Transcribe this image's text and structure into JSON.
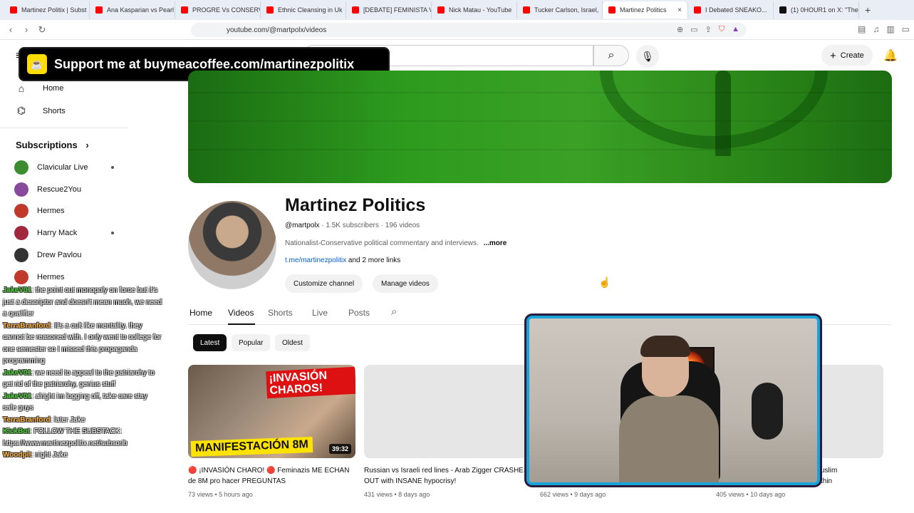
{
  "browser": {
    "tabs": [
      {
        "label": "Martinez Politix | Subst",
        "icon": "substack-icon"
      },
      {
        "label": "Ana Kasparian vs Pearl",
        "icon": "youtube-icon"
      },
      {
        "label": "PROGRE Vs CONSERV",
        "icon": "youtube-icon"
      },
      {
        "label": "Ethnic Cleansing in Uk",
        "icon": "youtube-icon"
      },
      {
        "label": "[DEBATE] FEMINISTA V",
        "icon": "youtube-icon"
      },
      {
        "label": "Nick Matau - YouTube",
        "icon": "youtube-icon"
      },
      {
        "label": "Tucker Carlson, Israel,",
        "icon": "youtube-icon"
      },
      {
        "label": "Martinez Politics",
        "icon": "youtube-icon",
        "active": true
      },
      {
        "label": "I Debated SNEAKO...",
        "icon": "youtube-icon"
      },
      {
        "label": "(1) 0HOUR1 on X: \"The",
        "icon": "x-icon"
      }
    ],
    "url": "youtube.com/@martpolx/videos"
  },
  "youtube_header": {
    "create_label": "Create"
  },
  "overlay_banner": {
    "text": "Support me at buymeacoffee.com/martinezpolitix"
  },
  "sidebar": {
    "nav": [
      {
        "label": "Home",
        "icon": "home-icon"
      },
      {
        "label": "Shorts",
        "icon": "shorts-icon"
      }
    ],
    "subscriptions_label": "Subscriptions",
    "subscriptions": [
      {
        "name": "Clavicular Live",
        "live": true,
        "color": "#3b8d2f"
      },
      {
        "name": "Rescue2You",
        "live": false,
        "color": "#8a4a9c"
      },
      {
        "name": "Hermes",
        "live": false,
        "color": "#c0392b"
      },
      {
        "name": "Harry Mack",
        "live": true,
        "color": "#a0283c"
      },
      {
        "name": "Drew Pavlou",
        "live": false,
        "color": "#333333"
      },
      {
        "name": "Hermes",
        "live": false,
        "color": "#c0392b"
      }
    ]
  },
  "chat": [
    {
      "user": "JakeV01",
      "text": ": the point out monopoly on force but it's just a descriptor and doesn't mean much, we need a qualifier"
    },
    {
      "user": "TerraBranford",
      "text": ": It's a cult like mentality. they cannot be reasoned with. I only went to college for one semester so I missed this propaganda programming"
    },
    {
      "user": "JakeV01",
      "text": ": we need to appeal to the patriarchy to get rid of the patriarchy, genius stuff"
    },
    {
      "user": "JakeV01",
      "text": ": alright im logging off, take care stay safe guys"
    },
    {
      "user": "TerraBranford",
      "text": ": later Jake"
    },
    {
      "user": "KickBot",
      "text": ": FOLLOW THE SUBSTACK: https://www.martinezpolitix.net/subscrib"
    },
    {
      "user": "Woodpit",
      "text": ": night Jake"
    }
  ],
  "channel": {
    "name": "Martinez Politics",
    "handle": "@martpolx",
    "subscribers": "1.5K subscribers",
    "videos_count": "196 videos",
    "description": "Nationalist-Conservative political commentary and interviews.",
    "more_label": "...more",
    "link": "t.me/martinezpolitix",
    "more_links": "and 2 more links",
    "customize_label": "Customize channel",
    "manage_label": "Manage videos"
  },
  "channel_tabs": [
    "Home",
    "Videos",
    "Shorts",
    "Live",
    "Posts"
  ],
  "filter_chips": [
    "Latest",
    "Popular",
    "Oldest"
  ],
  "videos": [
    {
      "title": "🔴 ¡INVASIÓN CHARO! 🔴 Feminazis ME ECHAN de 8M pro hacer PREGUNTAS",
      "meta": "73 views • 5 hours ago",
      "duration": "39:32",
      "thumb_text_top": "¡INVASIÓN CHAROS!",
      "thumb_text_bottom": "MANIFESTACIÓN 8M"
    },
    {
      "title": "Russian vs Israeli red lines - Arab Zigger CRASHES OUT with INSANE hypocrisy!",
      "meta": "431 views • 8 days ago"
    },
    {
      "title": "",
      "meta": "662 views • 9 days ago"
    },
    {
      "title": "uslim\nthin",
      "meta": "405 views • 10 days ago"
    }
  ]
}
